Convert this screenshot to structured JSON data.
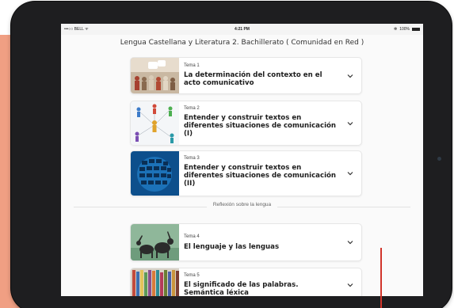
{
  "status_bar": {
    "carrier": "•••○○ BELL ᯤ",
    "time": "4:21 PM",
    "bluetooth": "✻",
    "battery": "100%"
  },
  "page_title": "Lengua Castellana y Literatura 2. Bachillerato ( Comunidad en Red )",
  "section_label": "Reflexión sobre la lengua",
  "topics": [
    {
      "tema": "Tema 1",
      "title": "La determinación del contexto en el acto comunicativo"
    },
    {
      "tema": "Tema 2",
      "title": "Entender y construir textos en diferentes situaciones de comunicación (I)"
    },
    {
      "tema": "Tema 3",
      "title": "Entender y construir textos en diferentes situaciones de comunicación (II)"
    },
    {
      "tema": "Tema 4",
      "title": "El lenguaje y las lenguas"
    },
    {
      "tema": "Tema 5",
      "title": "El significado de las palabras. Semántica léxica"
    }
  ],
  "colors": {
    "accent_panel": "#f09f83",
    "pointer_line": "#d1352b",
    "device": "#1e1e20"
  }
}
